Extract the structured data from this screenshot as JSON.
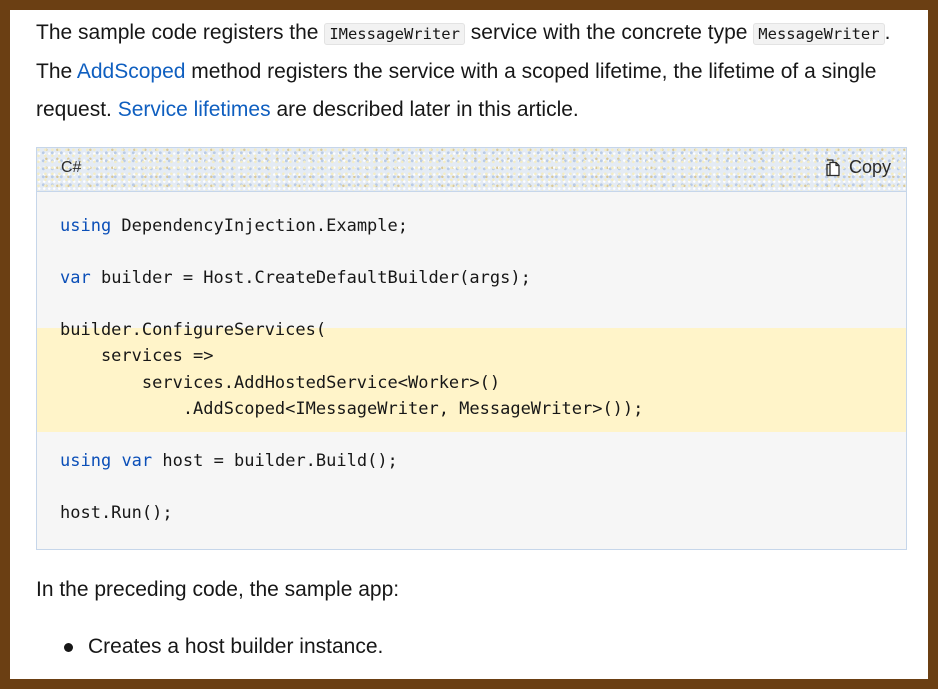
{
  "intro": {
    "t1": "The sample code registers the ",
    "code1": "IMessageWriter",
    "t2": " service with the concrete type ",
    "code2": "MessageWriter",
    "t3": ". The ",
    "link1": "AddScoped",
    "t4": " method registers the service with a scoped lifetime, the lifetime of a single request. ",
    "link2": "Service lifetimes",
    "t5": " are described later in this article."
  },
  "code_block": {
    "language": "C#",
    "copy_label": "Copy",
    "lines": {
      "l1_kw": "using",
      "l1_rest": " DependencyInjection.Example;",
      "l2_kw": "var",
      "l2_rest": " builder = Host.CreateDefaultBuilder(args);",
      "l3": "builder.ConfigureServices(",
      "l4": "    services =>",
      "l5": "        services.AddHostedService<Worker>()",
      "l6": "            .AddScoped<IMessageWriter, MessageWriter>());",
      "l7_kw1": "using",
      "l7_kw2": "var",
      "l7_rest": " host = builder.Build();",
      "l8": "host.Run();"
    }
  },
  "after": {
    "text": "In the preceding code, the sample app:",
    "bullets": [
      "Creates a host builder instance."
    ]
  },
  "colors": {
    "frame": "#6b3f13",
    "keyword": "#0b4fb8",
    "link": "#0f5fc0",
    "highlight": "#fff4c9"
  }
}
